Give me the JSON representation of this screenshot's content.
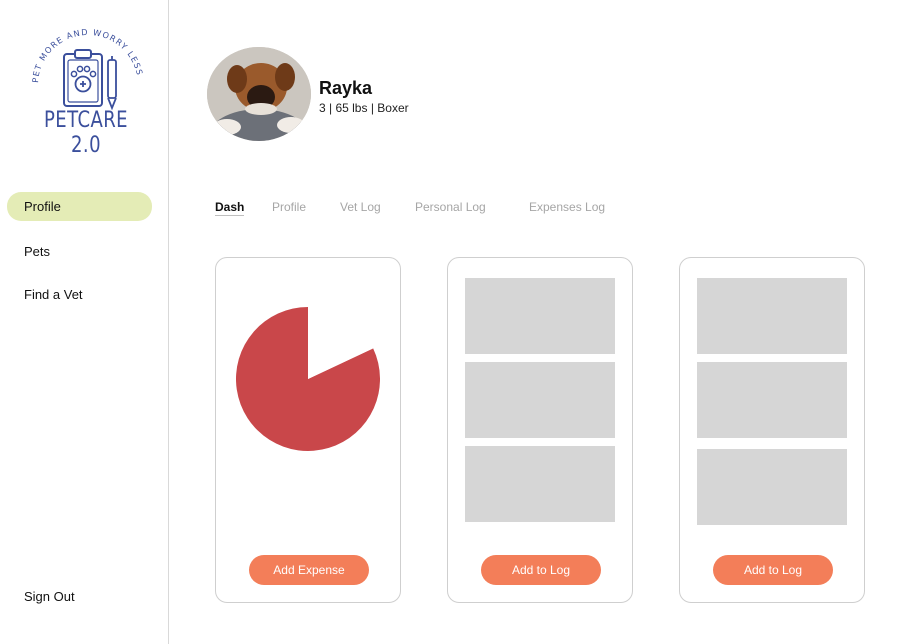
{
  "brand": {
    "tagline": "PET MORE AND WORRY LESS",
    "name": "PETCARE 2.0",
    "color": "#3b4f9c"
  },
  "sidebar": {
    "items": [
      {
        "label": "Profile",
        "active": true
      },
      {
        "label": "Pets",
        "active": false
      },
      {
        "label": "Find a Vet",
        "active": false
      }
    ],
    "sign_out": "Sign Out"
  },
  "pet": {
    "name": "Rayka",
    "details": "3 | 65 lbs | Boxer"
  },
  "tabs": [
    {
      "label": "Dash",
      "active": true
    },
    {
      "label": "Profile",
      "active": false
    },
    {
      "label": "Vet Log",
      "active": false
    },
    {
      "label": "Personal Log",
      "active": false
    },
    {
      "label": "Expenses Log",
      "active": false
    }
  ],
  "cards": [
    {
      "button": "Add Expense"
    },
    {
      "button": "Add to Log"
    },
    {
      "button": "Add to Log"
    }
  ],
  "colors": {
    "accent": "#f37e59",
    "active_nav": "#e4ecb6",
    "pie": "#c9474a",
    "placeholder": "#d6d6d6"
  },
  "chart_data": {
    "type": "pie",
    "values": [
      82,
      18
    ],
    "colors": [
      "#c9474a",
      "#ffffff"
    ]
  }
}
